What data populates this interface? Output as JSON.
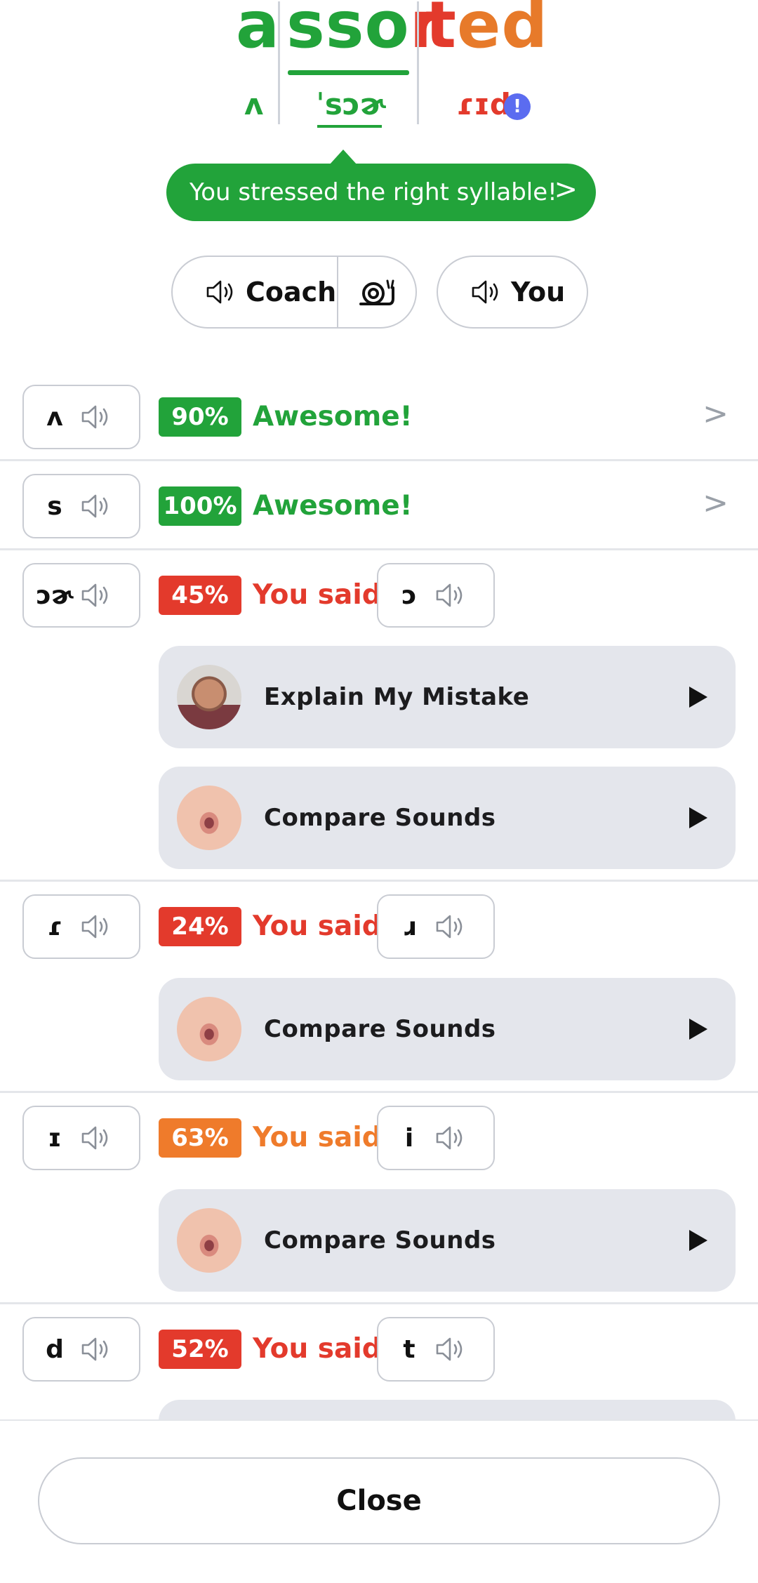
{
  "word": {
    "segments": [
      "a",
      "sso",
      "r",
      "t",
      "ed"
    ],
    "ipa": [
      "ʌ",
      "ˈsɔɚ",
      "ɾɪd"
    ],
    "info_icon": "!"
  },
  "tooltip": {
    "text": "You stressed the right syllable!",
    "chevron": ">"
  },
  "buttons": {
    "coach": "Coach",
    "you": "You"
  },
  "rows": [
    {
      "symbol": "ʌ",
      "score": "90%",
      "verdict": "Awesome!",
      "chevron": ">"
    },
    {
      "symbol": "s",
      "score": "100%",
      "verdict": "Awesome!",
      "chevron": ">"
    },
    {
      "symbol": "ɔɚ",
      "score": "45%",
      "verdict": "You said",
      "said": "ɔ",
      "cards": [
        "Explain My Mistake",
        "Compare Sounds"
      ]
    },
    {
      "symbol": "ɾ",
      "score": "24%",
      "verdict": "You said",
      "said": "ɹ",
      "cards": [
        "Compare Sounds"
      ]
    },
    {
      "symbol": "ɪ",
      "score": "63%",
      "verdict": "You said",
      "said": "i",
      "cards": [
        "Compare Sounds"
      ]
    },
    {
      "symbol": "d",
      "score": "52%",
      "verdict": "You said",
      "said": "t"
    }
  ],
  "footer": {
    "close": "Close"
  },
  "colors": {
    "good": "#22a33a",
    "bad": "#e33a2c",
    "mid": "#ef7b2b",
    "info": "#5b6cf0"
  },
  "icons": [
    "speaker-icon",
    "snail-icon",
    "chevron-right-icon",
    "play-icon",
    "info-icon"
  ]
}
